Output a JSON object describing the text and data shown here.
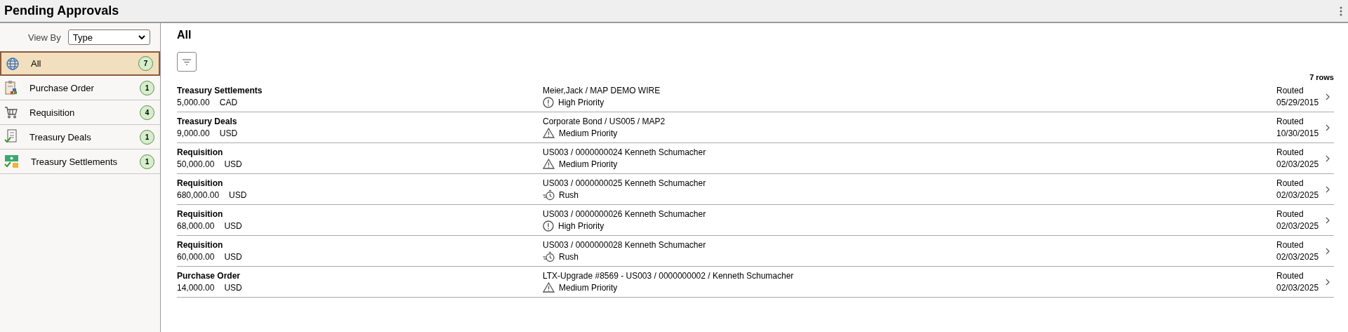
{
  "header": {
    "title": "Pending Approvals"
  },
  "sidebar": {
    "view_by": {
      "label": "View By",
      "value": "Type"
    },
    "items": [
      {
        "label": "All",
        "count": "7",
        "kind": "all",
        "selected": true
      },
      {
        "label": "Purchase Order",
        "count": "1",
        "kind": "purchase",
        "selected": false
      },
      {
        "label": "Requisition",
        "count": "4",
        "kind": "cart",
        "selected": false
      },
      {
        "label": "Treasury Deals",
        "count": "1",
        "kind": "deal",
        "selected": false
      },
      {
        "label": "Treasury Settlements",
        "count": "1",
        "kind": "settlement",
        "selected": false
      }
    ]
  },
  "main": {
    "title": "All",
    "row_count": "7 rows",
    "rows": [
      {
        "type": "Treasury Settlements",
        "amount": "5,000.00",
        "currency": "CAD",
        "description": "Meier,Jack / MAP DEMO WIRE",
        "priority": {
          "kind": "high",
          "label": "High Priority"
        },
        "status": "Routed",
        "date": "05/29/2015"
      },
      {
        "type": "Treasury Deals",
        "amount": "9,000.00",
        "currency": "USD",
        "description": "Corporate Bond / US005 / MAP2",
        "priority": {
          "kind": "medium",
          "label": "Medium Priority"
        },
        "status": "Routed",
        "date": "10/30/2015"
      },
      {
        "type": "Requisition",
        "amount": "50,000.00",
        "currency": "USD",
        "description": "US003 / 0000000024 Kenneth Schumacher",
        "priority": {
          "kind": "medium",
          "label": "Medium Priority"
        },
        "status": "Routed",
        "date": "02/03/2025"
      },
      {
        "type": "Requisition",
        "amount": "680,000.00",
        "currency": "USD",
        "description": "US003 / 0000000025 Kenneth Schumacher",
        "priority": {
          "kind": "rush",
          "label": "Rush"
        },
        "status": "Routed",
        "date": "02/03/2025"
      },
      {
        "type": "Requisition",
        "amount": "68,000.00",
        "currency": "USD",
        "description": "US003 / 0000000026 Kenneth Schumacher",
        "priority": {
          "kind": "high",
          "label": "High Priority"
        },
        "status": "Routed",
        "date": "02/03/2025"
      },
      {
        "type": "Requisition",
        "amount": "60,000.00",
        "currency": "USD",
        "description": "US003 / 0000000028 Kenneth Schumacher",
        "priority": {
          "kind": "rush",
          "label": "Rush"
        },
        "status": "Routed",
        "date": "02/03/2025"
      },
      {
        "type": "Purchase Order",
        "amount": "14,000.00",
        "currency": "USD",
        "description": "LTX-Upgrade #8569 - US003 / 0000000002 / Kenneth Schumacher",
        "priority": {
          "kind": "medium",
          "label": "Medium Priority"
        },
        "status": "Routed",
        "date": "02/03/2025"
      }
    ]
  }
}
